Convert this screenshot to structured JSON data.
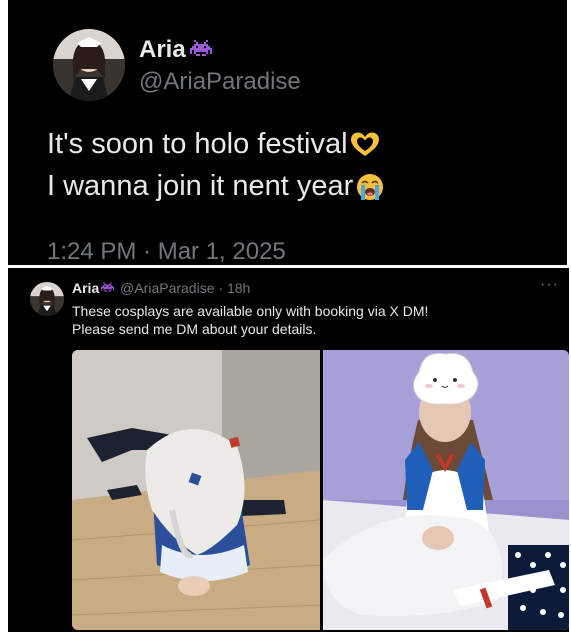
{
  "top_tweet": {
    "display_name": "Aria",
    "badge_icon": "space-invader-icon",
    "handle": "@AriaParadise",
    "text_line_1": "It's soon to holo festival",
    "emoji_1": "heart-hands-icon",
    "text_line_2": "I wanna join it nent year",
    "emoji_2": "loudly-crying-face-icon",
    "timestamp": "1:24 PM · Mar 1, 2025"
  },
  "bottom_tweet": {
    "display_name": "Aria",
    "badge_icon": "space-invader-icon",
    "handle": "@AriaParadise",
    "separator": "·",
    "time_ago": "18h",
    "more_icon": "more-options-icon",
    "more_glyph": "···",
    "body_line_1": "These cosplays are available only with booking via X DM!",
    "body_line_2": "Please send me DM about your details.",
    "photos": [
      {
        "icon": "photo-blue-maid-costume-kneeling"
      },
      {
        "icon": "photo-sailor-uniform-with-pillow"
      }
    ]
  },
  "colors": {
    "background": "#000000",
    "text": "#e7e9ea",
    "secondary_text": "#71767b",
    "badge_purple": "#9b59d6"
  }
}
